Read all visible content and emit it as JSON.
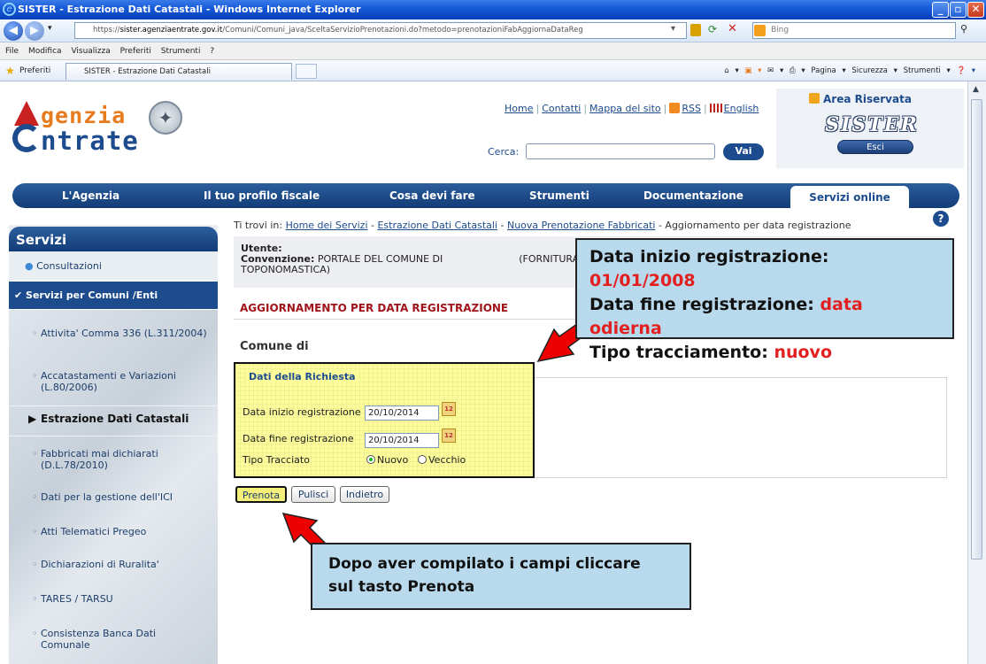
{
  "window": {
    "title": "SISTER - Estrazione Dati Catastali - Windows Internet Explorer",
    "url_scheme": "https://",
    "url_host": "sister.agenziaentrate.gov.it",
    "url_path": "/Comuni/Comuni_java/SceltaServizioPrenotazioni.do?metodo=prenotazioniFabAggiornaDataReg",
    "search_engine": "Bing"
  },
  "menubar": [
    "File",
    "Modifica",
    "Visualizza",
    "Preferiti",
    "Strumenti",
    "?"
  ],
  "favbar": {
    "favorites_label": "Preferiti",
    "tab_label": "SISTER - Estrazione Dati Catastali",
    "tools": [
      "Pagina ▾",
      "Sicurezza ▾",
      "Strumenti ▾"
    ]
  },
  "header": {
    "logo_line1": "genzia",
    "logo_line2": "ntrate",
    "links": [
      "Home",
      "Contatti",
      "Mappa del sito",
      "RSS",
      "English"
    ],
    "search_label": "Cerca:",
    "search_button": "Vai",
    "reserved_title": "Area Riservata",
    "sister_logo": "SISTER",
    "logout": "Esci"
  },
  "nav": [
    "L'Agenzia",
    "Il tuo profilo fiscale",
    "Cosa devi fare",
    "Strumenti",
    "Documentazione",
    "Servizi online"
  ],
  "sidebar": {
    "title": "Servizi",
    "items": [
      "Consultazioni",
      "Servizi per Comuni /Enti",
      "Attivita' Comma 336 (L.311/2004)",
      "Accatastamenti e Variazioni (L.80/2006)",
      "Estrazione Dati Catastali",
      "Fabbricati mai dichiarati (D.L.78/2010)",
      "Dati per la gestione dell'ICI",
      "Atti Telematici Pregeo",
      "Dichiarazioni di Ruralita'",
      "TARES / TARSU",
      "Consistenza Banca Dati Comunale"
    ]
  },
  "breadcrumb": {
    "prefix": "Ti trovi in:",
    "items": [
      "Home dei Servizi",
      "Estrazione Dati Catastali",
      "Nuova Prenotazione Fabbricati"
    ],
    "current": "Aggiornamento per data registrazione"
  },
  "user": {
    "utente_label": "Utente:",
    "convenzione_label": "Convenzione:",
    "convenzione_value": "PORTALE DEL COMUNE DI",
    "convenzione_suffix": "(FORNITURA T",
    "convenzione_line2": "TOPONOMASTICA)"
  },
  "section_title": "AGGIORNAMENTO PER DATA REGISTRAZIONE",
  "comune_label": "Comune di",
  "form": {
    "legend": "Dati della Richiesta",
    "start_label": "Data inizio registrazione",
    "start_value": "20/10/2014",
    "end_label": "Data fine registrazione",
    "end_value": "20/10/2014",
    "type_label": "Tipo Tracciato",
    "option_new": "Nuovo",
    "option_old": "Vecchio",
    "selected": "Nuovo"
  },
  "buttons": {
    "book": "Prenota",
    "clear": "Pulisci",
    "back": "Indietro"
  },
  "callout_top": {
    "line1_label": "Data inizio registrazione:",
    "line1_value": "01/01/2008",
    "line2_label": "Data fine registrazione:",
    "line2_value": "data odierna",
    "line3_label": "Tipo tracciamento:",
    "line3_value": "nuovo"
  },
  "callout_bottom": {
    "line1": "Dopo aver compilato i campi cliccare",
    "line2": "sul tasto Prenota"
  },
  "colors": {
    "brand_blue": "#1c4b8e",
    "brand_orange": "#e67c1f",
    "section_red": "#a0141a",
    "highlight_yellow": "#fcfc9a",
    "callout_bg": "#b9d9ec",
    "callout_red": "#e32020"
  }
}
